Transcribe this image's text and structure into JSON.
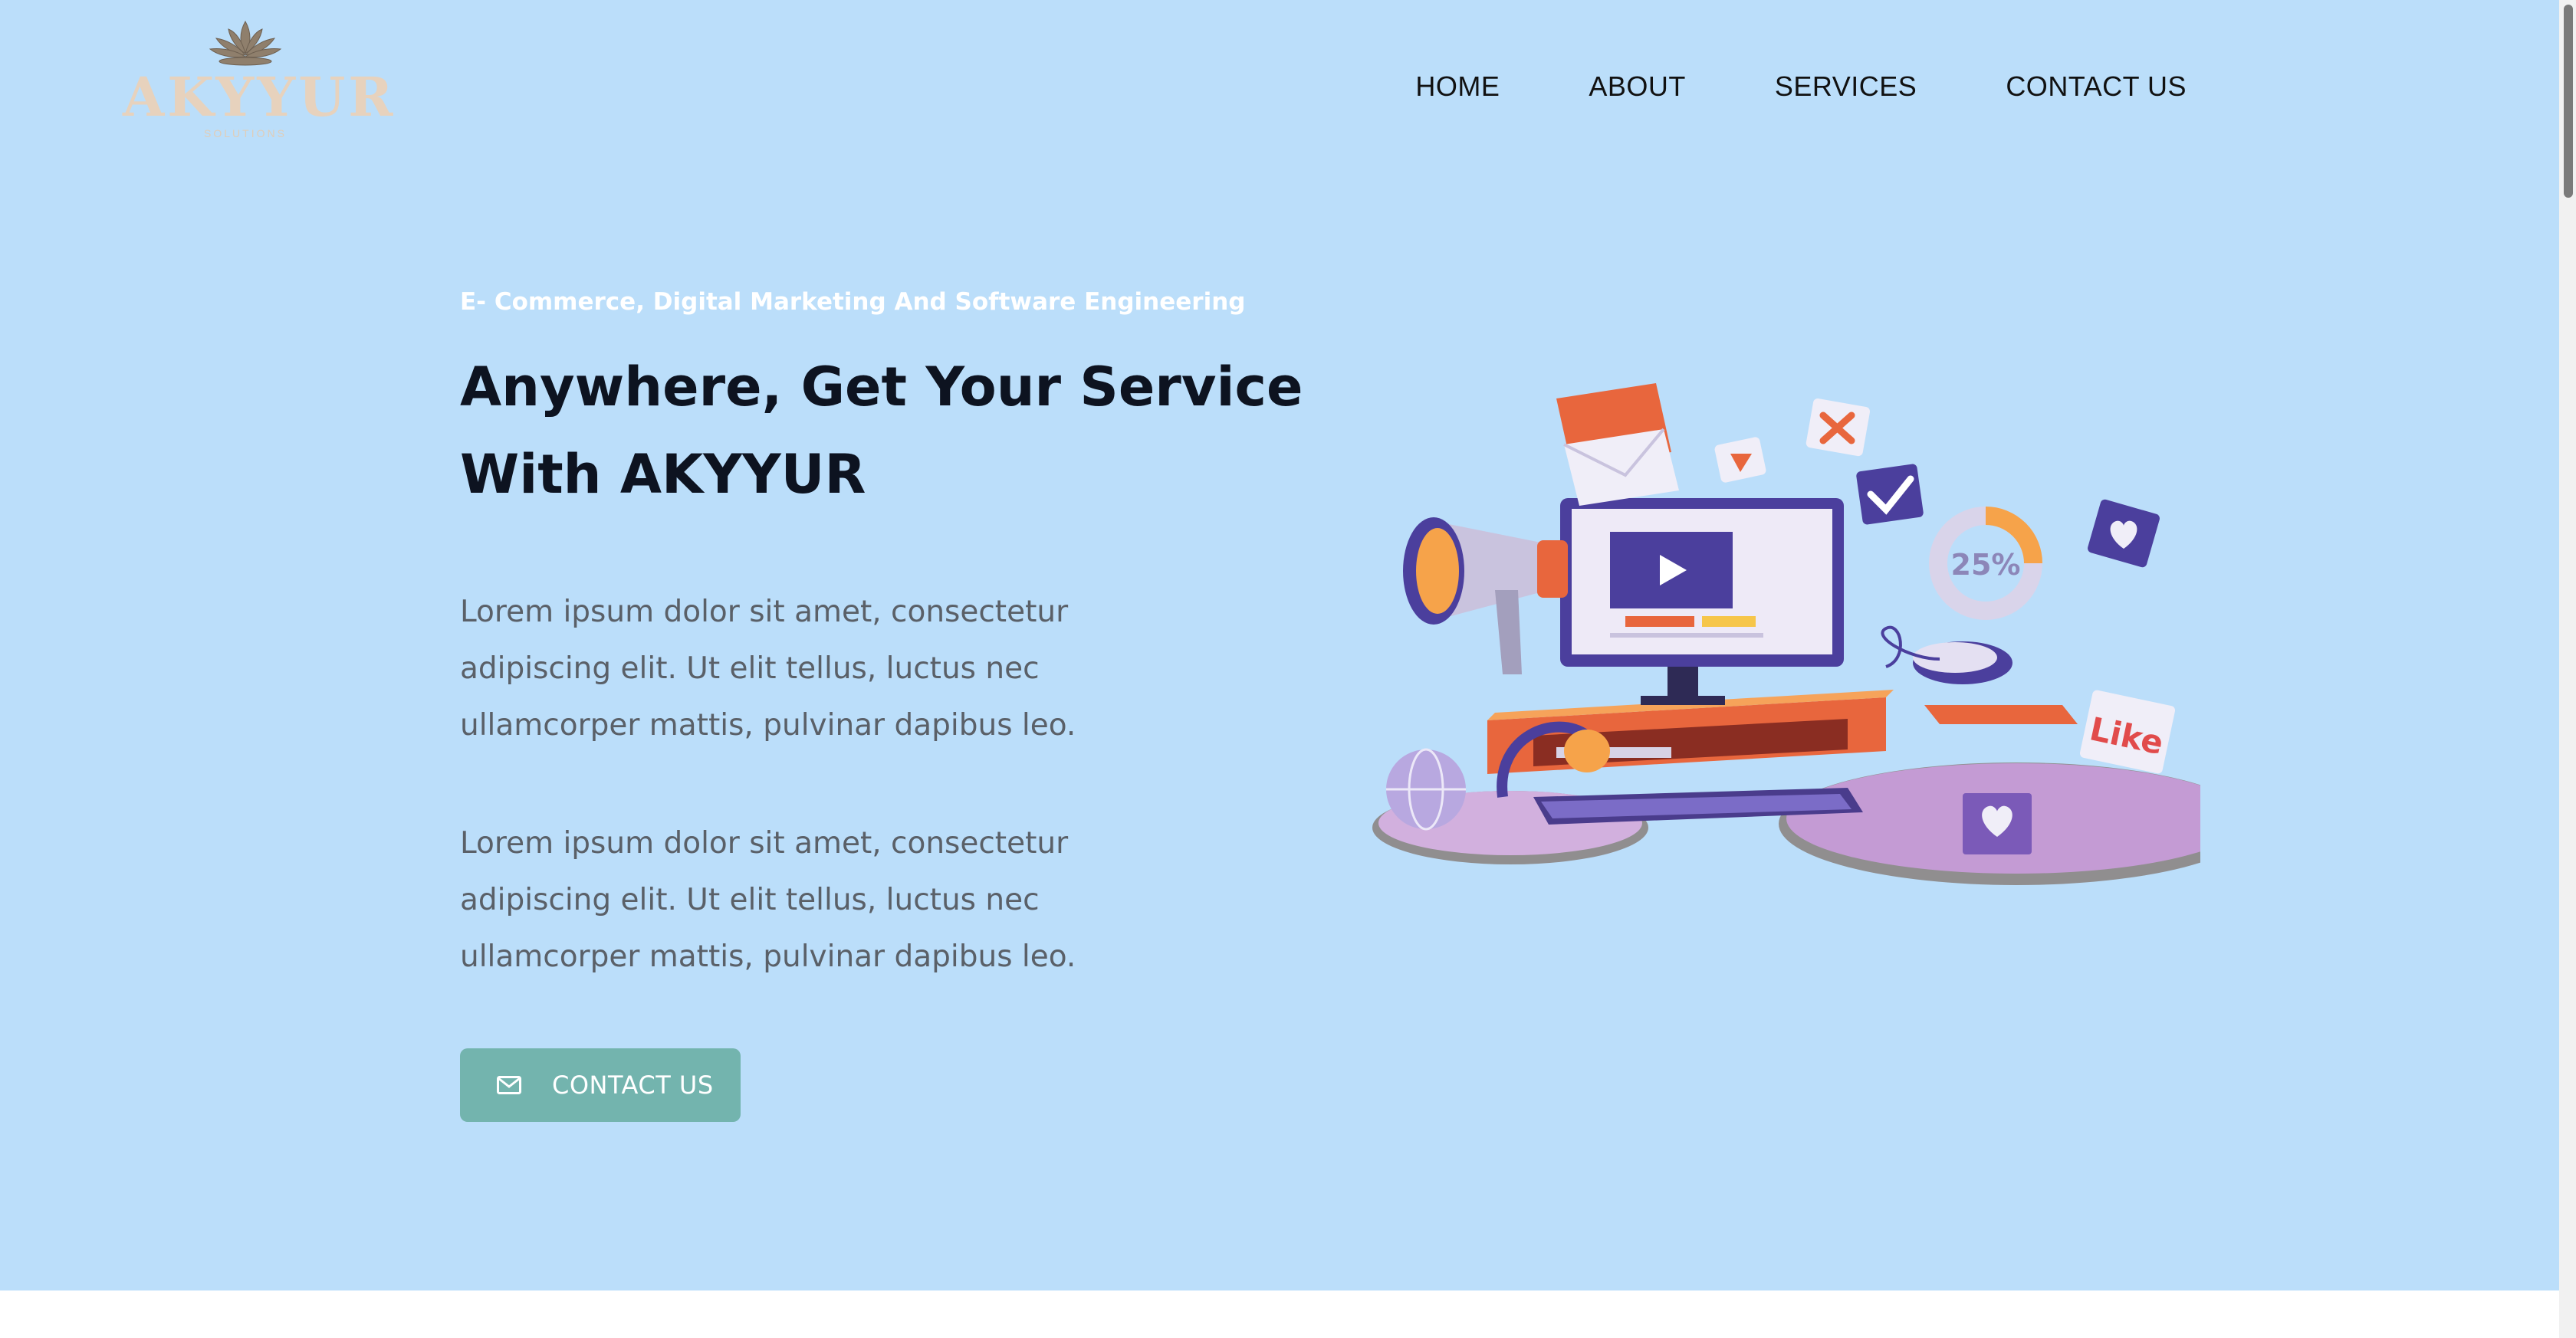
{
  "brand": {
    "logo_text": "AKYYUR",
    "logo_tagline": "SOLUTIONS"
  },
  "nav": {
    "items": [
      {
        "label": "HOME"
      },
      {
        "label": "ABOUT"
      },
      {
        "label": "SERVICES"
      },
      {
        "label": "CONTACT US"
      }
    ]
  },
  "hero": {
    "eyebrow": "E- Commerce, Digital Marketing And Software Engineering",
    "headline_line1": "Anywhere, Get Your Service",
    "headline_line2": "With AKYYUR",
    "paragraph1": "Lorem ipsum dolor sit amet, consectetur adipiscing elit. Ut elit tellus, luctus nec ullamcorper mattis, pulvinar dapibus leo.",
    "paragraph2": "Lorem ipsum dolor sit amet, consectetur adipiscing elit. Ut elit tellus, luctus nec ullamcorper mattis, pulvinar dapibus leo.",
    "cta_label": "CONTACT US",
    "cta_icon": "envelope-icon"
  },
  "illustration": {
    "discount_text": "25%",
    "like_text": "Like"
  },
  "colors": {
    "hero_bg": "#bbdefa",
    "cta_bg": "#73b4ae",
    "headline": "#0d1320",
    "eyebrow": "#ffffff"
  }
}
